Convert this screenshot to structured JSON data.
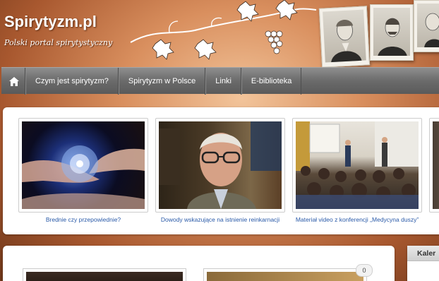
{
  "site": {
    "title": "Spirytyzm.pl",
    "tagline": "Polski portal spirytystyczny"
  },
  "nav": {
    "items": [
      {
        "label": "Czym jest spirytyzm?"
      },
      {
        "label": "Spirytyzm w Polsce"
      },
      {
        "label": "Linki"
      },
      {
        "label": "E-biblioteka"
      }
    ]
  },
  "slider": {
    "items": [
      {
        "caption": "Brednie czy przepowiednie?"
      },
      {
        "caption": "Dowody wskazujące na istnienie reinkarnacji"
      },
      {
        "caption": "Materiał video z konferencji „Medycyna duszy”"
      }
    ]
  },
  "bottom": {
    "comment_count": "0"
  },
  "sidebar": {
    "box_title": "Kaler"
  },
  "colors": {
    "link": "#2a5aa8",
    "nav_bg": "#6b6b6b",
    "background_warm": "#d98f5e"
  }
}
